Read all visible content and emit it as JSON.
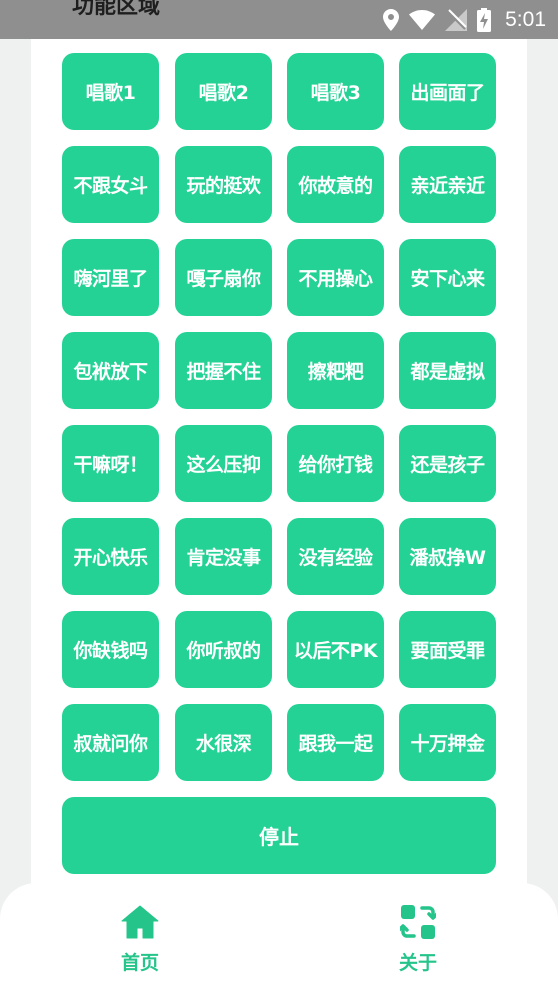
{
  "status_bar": {
    "title": "功能区域",
    "time": "5:01",
    "icons": [
      "location-icon",
      "wifi-icon",
      "no-signal-icon",
      "battery-charging-icon"
    ]
  },
  "buttons": [
    "唱歌1",
    "唱歌2",
    "唱歌3",
    "出画面了",
    "不跟女斗",
    "玩的挺欢",
    "你故意的",
    "亲近亲近",
    "嗨河里了",
    "嘎子扇你",
    "不用操心",
    "安下心来",
    "包袱放下",
    "把握不住",
    "擦粑粑",
    "都是虚拟",
    "干嘛呀！",
    "这么压抑",
    "给你打钱",
    "还是孩子",
    "开心快乐",
    "肯定没事",
    "没有经验",
    "潘叔挣W",
    "你缺钱吗",
    "你听叔的",
    "以后不PK",
    "要面受罪",
    "叔就问你",
    "水很深",
    "跟我一起",
    "十万押金"
  ],
  "stop_label": "停止",
  "nav": {
    "home_label": "首页",
    "home_icon": "home-icon",
    "about_label": "关于",
    "about_icon": "about-icon"
  },
  "colors": {
    "accent": "#24d295",
    "nav_label": "#24c48a",
    "status_bar": "#8e8f8e",
    "background": "#eef1ef"
  }
}
